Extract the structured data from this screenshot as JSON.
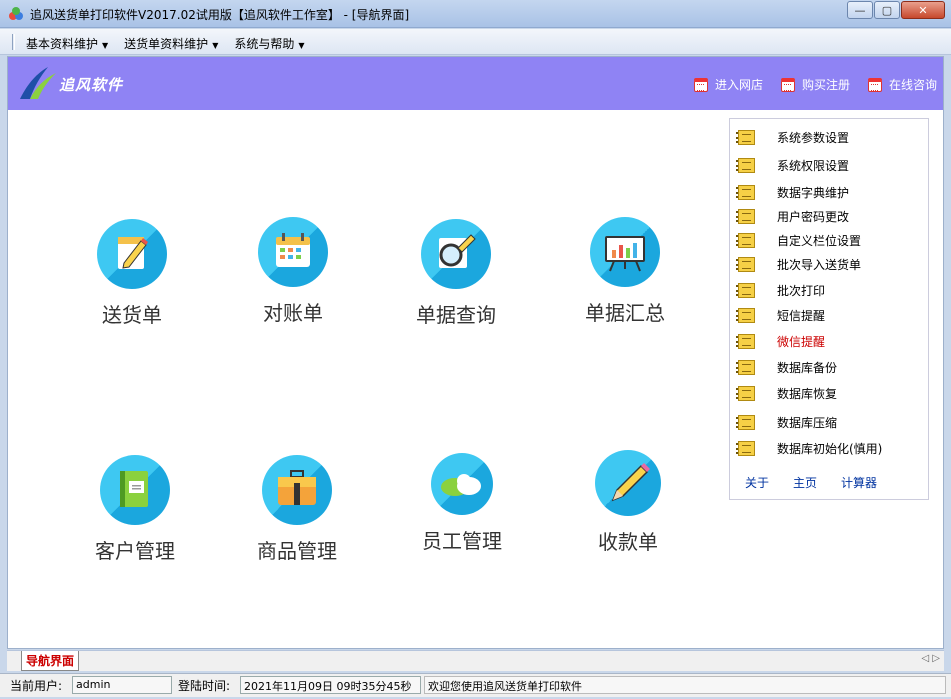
{
  "window": {
    "title": "追风送货单打印软件V2017.02试用版【追风软件工作室】 - [导航界面]",
    "buttons": {
      "minimize": "—",
      "maximize": "▢",
      "close": "✕"
    }
  },
  "menubar": {
    "items": [
      {
        "label": "基本资料维护"
      },
      {
        "label": "送货单资料维护"
      },
      {
        "label": "系统与帮助"
      }
    ]
  },
  "banner": {
    "brand": "追风软件",
    "links": [
      {
        "label": "进入网店",
        "icon": "calendar-icon"
      },
      {
        "label": "购买注册",
        "icon": "calendar-icon"
      },
      {
        "label": "在线咨询",
        "icon": "calendar-icon"
      }
    ],
    "color": "#8f83f4"
  },
  "tiles": [
    {
      "label": "送货单",
      "icon": "delivery-note-icon"
    },
    {
      "label": "对账单",
      "icon": "calendar-statement-icon"
    },
    {
      "label": "单据查询",
      "icon": "magnifier-icon"
    },
    {
      "label": "单据汇总",
      "icon": "chart-board-icon"
    },
    {
      "label": "客户管理",
      "icon": "notebook-icon"
    },
    {
      "label": "商品管理",
      "icon": "briefcase-icon"
    },
    {
      "label": "员工管理",
      "icon": "cloud-icon"
    },
    {
      "label": "收款单",
      "icon": "pencil-icon"
    }
  ],
  "panel": {
    "items": [
      {
        "label": "系统参数设置"
      },
      {
        "label": "系统权限设置"
      },
      {
        "label": "数据字典维护"
      },
      {
        "label": "用户密码更改"
      },
      {
        "label": "自定义栏位设置"
      },
      {
        "label": "批次导入送货单"
      },
      {
        "label": "批次打印"
      },
      {
        "label": "短信提醒"
      },
      {
        "label": "微信提醒"
      },
      {
        "label": "数据库备份"
      },
      {
        "label": "数据库恢复"
      },
      {
        "label": "数据库压缩"
      },
      {
        "label": "数据库初始化(慎用)"
      }
    ],
    "links": [
      {
        "label": "关于"
      },
      {
        "label": "主页"
      },
      {
        "label": "计算器"
      }
    ]
  },
  "tabstrip": {
    "active_tab": "导航界面",
    "arrows": "◁ ▷"
  },
  "statusbar": {
    "user_label": "当前用户:",
    "user_value": "admin",
    "login_label": "登陆时间:",
    "login_value": "2021年11月09日 09时35分45秒",
    "message": "欢迎您使用追风送货单打印软件"
  }
}
